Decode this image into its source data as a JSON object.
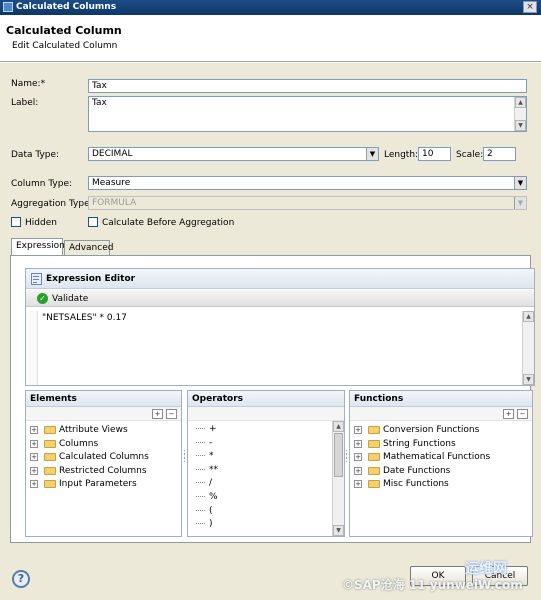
{
  "window": {
    "title": "Calculated Columns",
    "close_glyph": "×"
  },
  "header": {
    "title": "Calculated Column",
    "subtitle": "Edit Calculated Column"
  },
  "form": {
    "name_label": "Name:*",
    "name_value": "Tax",
    "label_label": "Label:",
    "label_value": "Tax",
    "data_type_label": "Data Type:",
    "data_type_value": "DECIMAL",
    "length_label": "Length:",
    "length_value": "10",
    "scale_label": "Scale:",
    "scale_value": "2",
    "column_type_label": "Column Type:",
    "column_type_value": "Measure",
    "aggregation_type_label": "Aggregation Type:",
    "aggregation_type_value": "FORMULA",
    "hidden_label": "Hidden",
    "hidden_checked": false,
    "calc_before_agg_label": "Calculate Before Aggregation",
    "calc_before_agg_checked": false
  },
  "tabs": [
    {
      "label": "Expression",
      "active": true
    },
    {
      "label": "Advanced",
      "active": false
    }
  ],
  "expression_editor": {
    "title": "Expression Editor",
    "validate_label": "Validate",
    "expression": "\"NETSALES\" * 0.17"
  },
  "elements_pane": {
    "title": "Elements",
    "items": [
      "Attribute Views",
      "Columns",
      "Calculated Columns",
      "Restricted Columns",
      "Input Parameters"
    ]
  },
  "operators_pane": {
    "title": "Operators",
    "items": [
      "+",
      "-",
      "*",
      "**",
      "/",
      "%",
      "(",
      ")",
      "="
    ]
  },
  "functions_pane": {
    "title": "Functions",
    "items": [
      "Conversion Functions",
      "String Functions",
      "Mathematical Functions",
      "Date Functions",
      "Misc Functions"
    ]
  },
  "footer": {
    "help_glyph": "?",
    "buttons": [
      "OK",
      "Cancel"
    ],
    "watermark_text": "©SAP沧海 11 yunweiW.com",
    "watermark_logo": "运维网"
  },
  "colors": {
    "titlebar": "#0e3768",
    "dialog_bg": "#ece9d8",
    "validate_ok": "#2aa02a"
  }
}
